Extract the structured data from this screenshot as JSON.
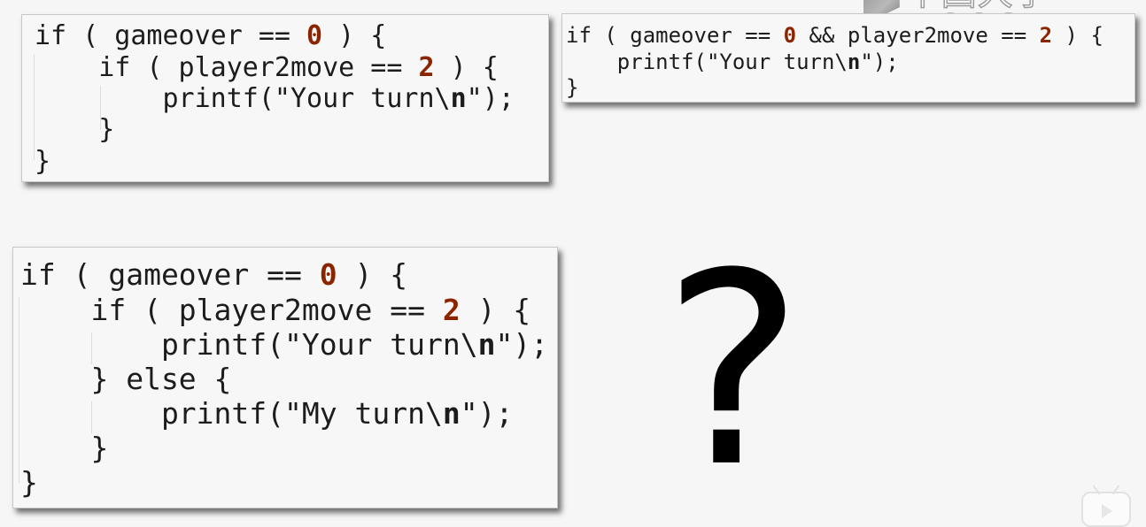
{
  "watermark": {
    "text": "中国大学MOOC"
  },
  "snippet_nested": {
    "lines": [
      {
        "pre": "if ( gameover == ",
        "num": "0",
        "post": " ) {"
      },
      {
        "pre": "    if ( player2move == ",
        "num": "2",
        "post": " ) {"
      },
      {
        "pre": "        printf(\"Your turn\\",
        "num": "n",
        "post": "\");"
      },
      {
        "pre": "    }",
        "num": "",
        "post": ""
      },
      {
        "pre": "}",
        "num": "",
        "post": ""
      }
    ]
  },
  "snippet_combined": {
    "lines": [
      {
        "pre": "if ( gameover == ",
        "num": "0",
        "mid": " && player2move == ",
        "num2": "2",
        "post": " ) {"
      },
      {
        "pre": "    printf(\"Your turn\\",
        "num": "n",
        "mid": "\");",
        "num2": "",
        "post": ""
      },
      {
        "pre": "}",
        "num": "",
        "mid": "",
        "num2": "",
        "post": ""
      }
    ]
  },
  "snippet_else": {
    "lines": [
      {
        "pre": "if ( gameover == ",
        "num": "0",
        "post": " ) {"
      },
      {
        "pre": "    if ( player2move == ",
        "num": "2",
        "post": " ) {"
      },
      {
        "pre": "        printf(\"Your turn\\",
        "num": "n",
        "post": "\");"
      },
      {
        "pre": "    } else {",
        "num": "",
        "post": ""
      },
      {
        "pre": "        printf(\"My turn\\",
        "num": "n",
        "post": "\");"
      },
      {
        "pre": "    }",
        "num": "",
        "post": ""
      },
      {
        "pre": "}",
        "num": "",
        "post": ""
      }
    ]
  },
  "question_mark": "?"
}
